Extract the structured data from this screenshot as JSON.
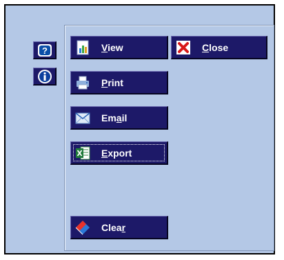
{
  "buttons": {
    "view": {
      "pre": "",
      "key": "V",
      "post": "iew"
    },
    "close": {
      "pre": "",
      "key": "C",
      "post": "lose"
    },
    "print": {
      "pre": "",
      "key": "P",
      "post": "rint"
    },
    "email": {
      "pre": "Em",
      "key": "a",
      "post": "il"
    },
    "export": {
      "pre": "",
      "key": "E",
      "post": "xport"
    },
    "clear": {
      "pre": "Clea",
      "key": "r",
      "post": ""
    }
  },
  "icons": {
    "help": "question-icon",
    "info": "info-icon",
    "view": "chart-document-icon",
    "close": "red-x-icon",
    "print": "printer-icon",
    "email": "envelope-icon",
    "export": "excel-icon",
    "clear": "eraser-icon"
  },
  "colors": {
    "background": "#b4c8e6",
    "button": "#1d1968",
    "text": "#ffffff"
  }
}
